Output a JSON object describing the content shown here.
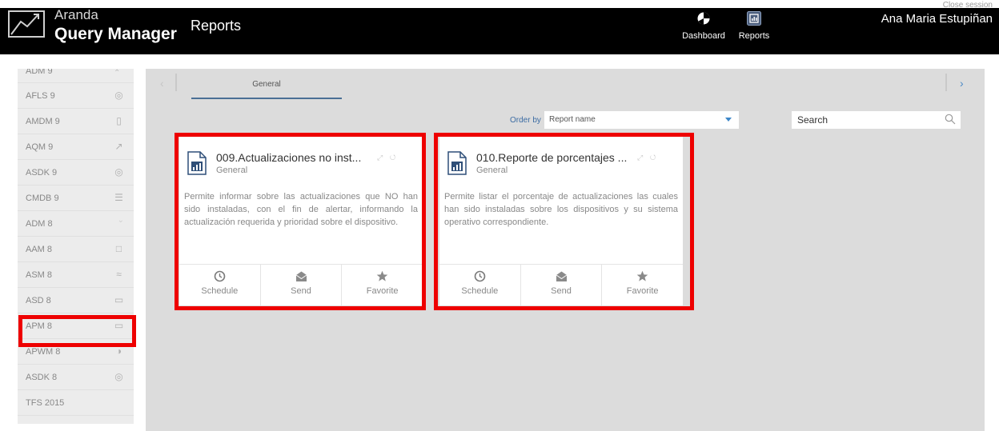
{
  "header": {
    "logo_line1": "Aranda",
    "logo_line2": "Query Manager",
    "page_title": "Reports",
    "nav": [
      {
        "label": "Dashboard",
        "icon": "pie-chart-icon"
      },
      {
        "label": "Reports",
        "icon": "report-icon"
      }
    ],
    "close_session": "Close session",
    "user_name": "Ana Maria Estupiñan"
  },
  "sidebar": {
    "items": [
      {
        "label": "ADM 9",
        "icon": "chevron-up-icon"
      },
      {
        "label": "AFLS 9",
        "icon": "license-icon"
      },
      {
        "label": "AMDM 9",
        "icon": "mobile-icon"
      },
      {
        "label": "AQM 9",
        "icon": "chart-line-icon"
      },
      {
        "label": "ASDK 9",
        "icon": "support-icon"
      },
      {
        "label": "CMDB 9",
        "icon": "database-icon"
      },
      {
        "label": "ADM 8",
        "icon": "chevron-down-icon"
      },
      {
        "label": "AAM 8",
        "icon": "document-icon"
      },
      {
        "label": "ASM 8",
        "icon": "network-icon"
      },
      {
        "label": "ASD 8",
        "icon": "monitor-icon"
      },
      {
        "label": "APM 8",
        "icon": "power-icon"
      },
      {
        "label": "APWM 8",
        "icon": "gauge-icon"
      },
      {
        "label": "ASDK 8",
        "icon": "support-icon"
      },
      {
        "label": "TFS 2015",
        "icon": ""
      }
    ]
  },
  "tabs": [
    {
      "label": "General",
      "active": true
    }
  ],
  "toolbar": {
    "order_by_label": "Order by",
    "order_by_value": "Report name",
    "search_placeholder": "Search"
  },
  "reports": [
    {
      "title": "009.Actualizaciones no inst...",
      "category": "General",
      "description": "Permite informar sobre las actualizaciones que NO han sido instaladas, con el fin de alertar, informando la actualización requerida y prioridad sobre el dispositivo.",
      "actions": [
        "Schedule",
        "Send",
        "Favorite"
      ]
    },
    {
      "title": "010.Reporte de porcentajes ...",
      "category": "General",
      "description": "Permite listar el porcentaje de actualizaciones las cuales han sido instaladas sobre los dispositivos y su sistema operativo correspondiente.",
      "actions": [
        "Schedule",
        "Send",
        "Favorite"
      ]
    }
  ],
  "colors": {
    "header_bg": "#000000",
    "accent": "#3d87c9",
    "highlight": "#ee0000",
    "main_bg": "#dcdcdc"
  }
}
